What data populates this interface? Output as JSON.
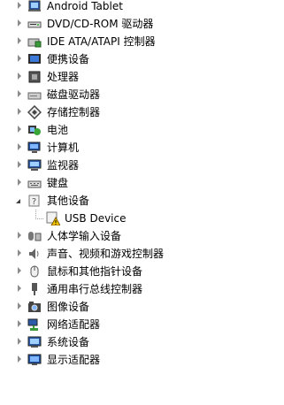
{
  "devices": [
    {
      "label": "Android Tablet",
      "icon": "tablet-icon"
    },
    {
      "label": "DVD/CD-ROM 驱动器",
      "icon": "dvd-drive-icon"
    },
    {
      "label": "IDE ATA/ATAPI 控制器",
      "icon": "ide-controller-icon"
    },
    {
      "label": "便携设备",
      "icon": "portable-device-icon"
    },
    {
      "label": "处理器",
      "icon": "processor-icon"
    },
    {
      "label": "磁盘驱动器",
      "icon": "disk-drive-icon"
    },
    {
      "label": "存储控制器",
      "icon": "storage-controller-icon"
    },
    {
      "label": "电池",
      "icon": "battery-icon"
    },
    {
      "label": "计算机",
      "icon": "computer-icon"
    },
    {
      "label": "监视器",
      "icon": "monitor-icon"
    },
    {
      "label": "键盘",
      "icon": "keyboard-icon"
    },
    {
      "label": "其他设备",
      "icon": "unknown-device-icon",
      "expanded": true,
      "children": [
        {
          "label": "USB Device",
          "icon": "warning-device-icon"
        }
      ]
    },
    {
      "label": "人体学输入设备",
      "icon": "hid-icon"
    },
    {
      "label": "声音、视频和游戏控制器",
      "icon": "sound-icon"
    },
    {
      "label": "鼠标和其他指针设备",
      "icon": "mouse-icon"
    },
    {
      "label": "通用串行总线控制器",
      "icon": "usb-icon"
    },
    {
      "label": "图像设备",
      "icon": "imaging-icon"
    },
    {
      "label": "网络适配器",
      "icon": "network-icon"
    },
    {
      "label": "系统设备",
      "icon": "system-icon"
    },
    {
      "label": "显示适配器",
      "icon": "display-adapter-icon"
    }
  ]
}
